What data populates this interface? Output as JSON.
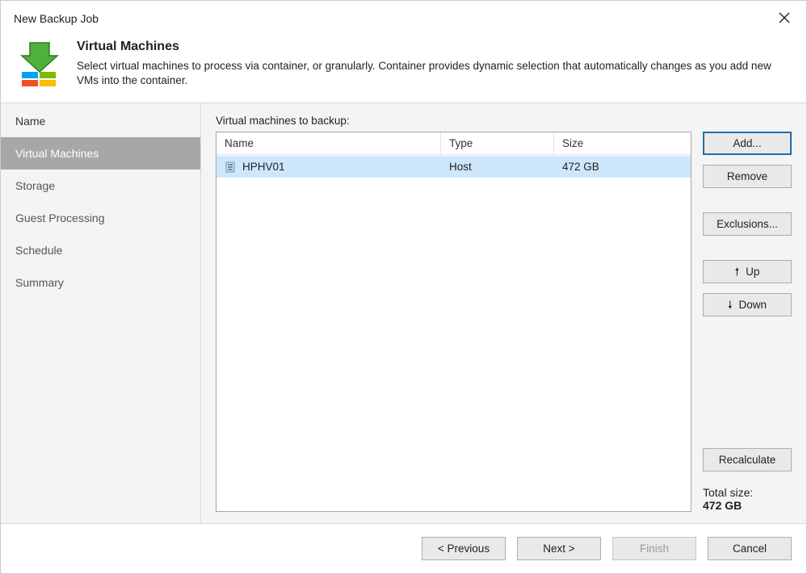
{
  "window": {
    "title": "New Backup Job"
  },
  "header": {
    "title": "Virtual Machines",
    "description": "Select virtual machines to process via container, or granularly. Container provides dynamic selection that automatically changes as you add new VMs into the container."
  },
  "sidebar": {
    "items": [
      {
        "label": "Name",
        "state": "done"
      },
      {
        "label": "Virtual Machines",
        "state": "active"
      },
      {
        "label": "Storage",
        "state": "future"
      },
      {
        "label": "Guest Processing",
        "state": "future"
      },
      {
        "label": "Schedule",
        "state": "future"
      },
      {
        "label": "Summary",
        "state": "future"
      }
    ]
  },
  "main": {
    "section_label": "Virtual machines to backup:",
    "columns": {
      "name": "Name",
      "type": "Type",
      "size": "Size"
    },
    "rows": [
      {
        "name": "HPHV01",
        "type": "Host",
        "size": "472 GB",
        "selected": true
      }
    ],
    "total_label": "Total size:",
    "total_value": "472 GB"
  },
  "buttons": {
    "add": "Add...",
    "remove": "Remove",
    "exclusions": "Exclusions...",
    "up": "Up",
    "down": "Down",
    "recalculate": "Recalculate",
    "previous": "< Previous",
    "next": "Next >",
    "finish": "Finish",
    "cancel": "Cancel"
  }
}
